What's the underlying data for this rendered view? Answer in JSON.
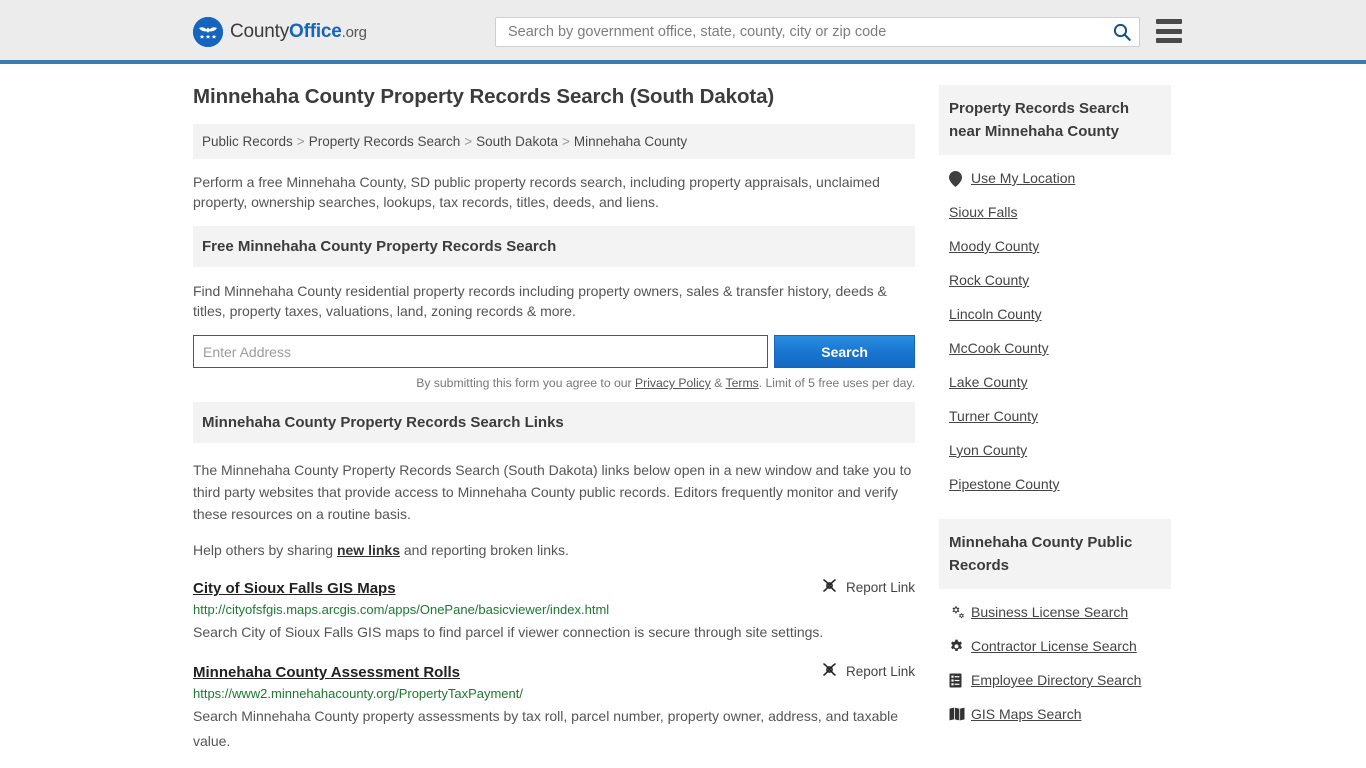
{
  "header": {
    "logo": {
      "text_plain": "County",
      "text_bold": "Office",
      "text_suffix": ".org",
      "icon": "eagle-seal-icon"
    },
    "search": {
      "placeholder": "Search by government office, state, county, city or zip code",
      "value": "",
      "icon": "search-icon"
    },
    "menu_icon": "hamburger-menu-icon",
    "accent_color": "#3b7cb0"
  },
  "page": {
    "title": "Minnehaha County Property Records Search (South Dakota)",
    "breadcrumb": [
      "Public Records",
      "Property Records Search",
      "South Dakota",
      "Minnehaha County"
    ],
    "breadcrumb_separator": ">",
    "intro": "Perform a free Minnehaha County, SD public property records search, including property appraisals, unclaimed property, ownership searches, lookups, tax records, titles, deeds, and liens."
  },
  "free_search": {
    "heading": "Free Minnehaha County Property Records Search",
    "description": "Find Minnehaha County residential property records including property owners, sales & transfer history, deeds & titles, property taxes, valuations, land, zoning records & more.",
    "address_placeholder": "Enter Address",
    "address_value": "",
    "submit_label": "Search",
    "submit_color": "#1976d2",
    "fineprint_before": "By submitting this form you agree to our ",
    "fineprint_privacy": "Privacy Policy",
    "fineprint_amp": " & ",
    "fineprint_terms": "Terms",
    "fineprint_after": ". Limit of 5 free uses per day."
  },
  "search_links": {
    "heading": "Minnehaha County Property Records Search Links",
    "paragraph": "The Minnehaha County Property Records Search (South Dakota) links below open in a new window and take you to third party websites that provide access to Minnehaha County public records. Editors frequently monitor and verify these resources on a routine basis.",
    "help_before": "Help others by sharing ",
    "help_link": "new links",
    "help_after": " and reporting broken links.",
    "report_label": "Report Link",
    "report_icon": "broken-link-icon",
    "items": [
      {
        "title": "City of Sioux Falls GIS Maps",
        "url": "http://cityofsfgis.maps.arcgis.com/apps/OnePane/basicviewer/index.html",
        "description": "Search City of Sioux Falls GIS maps to find parcel if viewer connection is secure through site settings."
      },
      {
        "title": "Minnehaha County Assessment Rolls",
        "url": "https://www2.minnehahacounty.org/PropertyTaxPayment/",
        "description": "Search Minnehaha County property assessments by tax roll, parcel number, property owner, address, and taxable value."
      }
    ]
  },
  "sidebar": {
    "nearby": {
      "heading": "Property Records Search near Minnehaha County",
      "items": [
        {
          "label": "Use My Location",
          "icon": "map-pin-icon"
        },
        {
          "label": "Sioux Falls",
          "icon": ""
        },
        {
          "label": "Moody County",
          "icon": ""
        },
        {
          "label": "Rock County",
          "icon": ""
        },
        {
          "label": "Lincoln County",
          "icon": ""
        },
        {
          "label": "McCook County",
          "icon": ""
        },
        {
          "label": "Lake County",
          "icon": ""
        },
        {
          "label": "Turner County",
          "icon": ""
        },
        {
          "label": "Lyon County",
          "icon": ""
        },
        {
          "label": "Pipestone County",
          "icon": ""
        }
      ]
    },
    "public_records": {
      "heading": "Minnehaha County Public Records",
      "items": [
        {
          "label": "Business License Search",
          "icon": "gears-icon"
        },
        {
          "label": "Contractor License Search",
          "icon": "gear-icon"
        },
        {
          "label": "Employee Directory Search",
          "icon": "list-document-icon"
        },
        {
          "label": "GIS Maps Search",
          "icon": "map-book-icon"
        }
      ]
    }
  }
}
